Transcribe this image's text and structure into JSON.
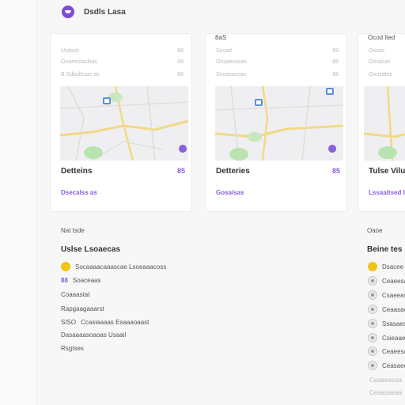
{
  "brand": {
    "name": "Dsdls Lasa"
  },
  "cards": [
    {
      "head": "",
      "rows": [
        {
          "label": "Usdwst",
          "value": "88"
        },
        {
          "label": "Ooaesstaslsas",
          "value": "68"
        },
        {
          "label": "B Sdbolbsas as",
          "value": "88"
        }
      ],
      "title": "Detteins",
      "badge": "85",
      "link": "Dsecalss as"
    },
    {
      "head": "8aS",
      "rows": [
        {
          "label": "Sosad",
          "value": "89"
        },
        {
          "label": "Oosaeussas",
          "value": "88"
        },
        {
          "label": "Socaoacsas",
          "value": "88"
        }
      ],
      "title": "Detteries",
      "badge": "85",
      "link": "Gosaisas"
    },
    {
      "head": "Ocod lted",
      "rows": [
        {
          "label": "Oosas",
          "value": ""
        },
        {
          "label": "Oosasas",
          "value": ""
        },
        {
          "label": "Oousdtes",
          "value": ""
        }
      ],
      "title": "Tulse Vilu",
      "badge": "",
      "link": "Lssaaitsed I"
    }
  ],
  "left_section": {
    "label": "Nat tsde",
    "title": "Uslse Lsoaecas",
    "rows": [
      {
        "icon": "yellow-dot",
        "prefix": "",
        "text": "Socaaaacaaascae Lsoeaaacoss"
      },
      {
        "icon": "",
        "prefix": "88",
        "text": "Soaceaas"
      },
      {
        "icon": "",
        "prefix": "",
        "text": "Coaaastat"
      },
      {
        "icon": "",
        "prefix": "",
        "text": "Rapgaagaaarst"
      },
      {
        "icon": "",
        "prefix": "SISO",
        "text": "Ccasiaaaas Esaaaoaast"
      },
      {
        "icon": "",
        "prefix": "",
        "text": "Dasaaaasoaoas Usaail"
      },
      {
        "icon": "",
        "prefix": "",
        "text": "Rsgtses"
      }
    ]
  },
  "right_section": {
    "label": "Oaoe",
    "title": "Beine tes",
    "rows": [
      {
        "icon": "yellow-dot",
        "text": "Dsacee"
      },
      {
        "icon": "grey-dot",
        "text": "Ceaeesas"
      },
      {
        "icon": "grey-dot",
        "text": "Csaeeasas"
      },
      {
        "icon": "grey-dot",
        "text": "Ceaasaes"
      },
      {
        "icon": "grey-dot",
        "text": "Ssasaes"
      },
      {
        "icon": "grey-dot",
        "text": "Csieaaeaas"
      },
      {
        "icon": "grey-dot",
        "text": "Ceaeesaa"
      },
      {
        "icon": "grey-dot",
        "text": "Ceasaeeeas"
      },
      {
        "icon": "",
        "text": "Ceaaeasaa"
      },
      {
        "icon": "",
        "text": "Ceaasaeaa"
      }
    ]
  },
  "colors": {
    "accent": "#8a5fd8",
    "brand": "#7b4fd1",
    "highlight": "#f0c419"
  }
}
